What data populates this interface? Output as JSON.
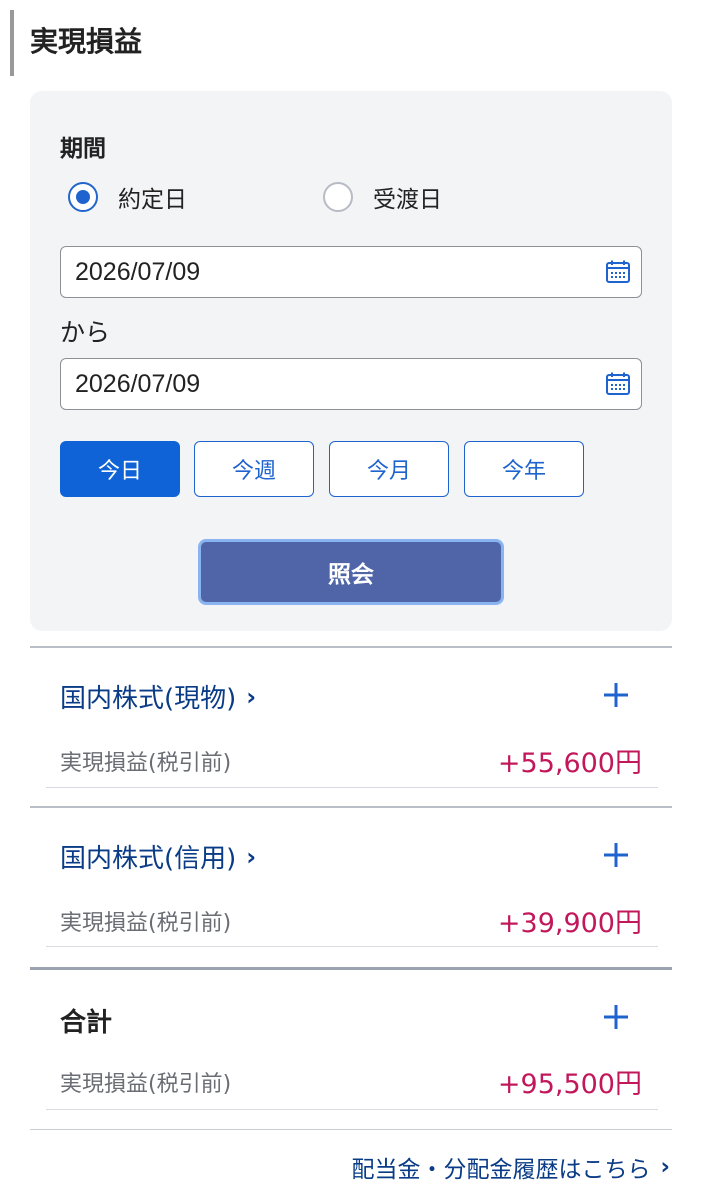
{
  "header": {
    "title": "実現損益"
  },
  "filter": {
    "period_label": "期間",
    "radio_options": [
      {
        "label": "約定日",
        "checked": true
      },
      {
        "label": "受渡日",
        "checked": false
      }
    ],
    "date_from": "2026/07/09",
    "from_suffix": "から",
    "date_to": "2026/07/09",
    "quick_buttons": [
      {
        "label": "今日",
        "active": true
      },
      {
        "label": "今週",
        "active": false
      },
      {
        "label": "今月",
        "active": false
      },
      {
        "label": "今年",
        "active": false
      }
    ],
    "submit_label": "照会"
  },
  "results": [
    {
      "title": "国内株式(現物)",
      "link": true,
      "label": "実現損益(税引前)",
      "value": "+55,600円"
    },
    {
      "title": "国内株式(信用)",
      "link": true,
      "label": "実現損益(税引前)",
      "value": "+39,900円"
    },
    {
      "title": "合計",
      "link": false,
      "label": "実現損益(税引前)",
      "value": "+95,500円"
    }
  ],
  "footer": {
    "dividend_link": "配当金・分配金履歴はこちら"
  },
  "colors": {
    "accent_blue": "#1f63cf",
    "link_navy": "#0a3b86",
    "profit_pink": "#c2185b",
    "submit_bg": "#4f65a8"
  }
}
